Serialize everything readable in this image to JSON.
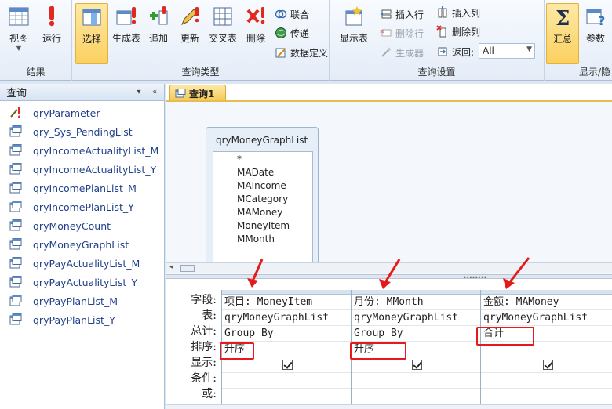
{
  "ribbon": {
    "results_group": {
      "label": "结果",
      "view": "视图",
      "run": "运行"
    },
    "query_type_group": {
      "label": "查询类型",
      "select": "选择",
      "make_table": "生成表",
      "append": "追加",
      "update": "更新",
      "crosstab": "交叉表",
      "delete": "删除",
      "union": "联合",
      "pass_through": "传递",
      "data_definition": "数据定义"
    },
    "query_setup_group": {
      "label": "查询设置",
      "show_table": "显示表",
      "insert_rows": "插入行",
      "delete_rows": "删除行",
      "builder": "生成器",
      "insert_columns": "插入列",
      "delete_columns": "删除列",
      "return": "返回:",
      "return_value": "All"
    },
    "show_hide_group": {
      "label": "显示/隐",
      "totals": "汇总",
      "parameters": "参数"
    }
  },
  "nav": {
    "title": "查询",
    "items": [
      "qryParameter",
      "qry_Sys_PendingList",
      "qryIncomeActualityList_M",
      "qryIncomeActualityList_Y",
      "qryIncomePlanList_M",
      "qryIncomePlanList_Y",
      "qryMoneyCount",
      "qryMoneyGraphList",
      "qryPayActualityList_M",
      "qryPayActualityList_Y",
      "qryPayPlanList_M",
      "qryPayPlanList_Y"
    ]
  },
  "doc": {
    "tab": "查询1",
    "table": {
      "name": "qryMoneyGraphList",
      "fields": [
        "*",
        "MADate",
        "MAIncome",
        "MCategory",
        "MAMoney",
        "MoneyItem",
        "MMonth"
      ]
    },
    "grid": {
      "row_labels": [
        "字段:",
        "表:",
        "总计:",
        "排序:",
        "显示:",
        "条件:",
        "或:"
      ],
      "columns": [
        {
          "field": "项目: MoneyItem",
          "table": "qryMoneyGraphList",
          "total": "Group By",
          "sort": "升序",
          "show": true
        },
        {
          "field": "月份: MMonth",
          "table": "qryMoneyGraphList",
          "total": "Group By",
          "sort": "升序",
          "show": true
        },
        {
          "field": "金额: MAMoney",
          "table": "qryMoneyGraphList",
          "total": "合计",
          "sort": "",
          "show": true
        }
      ]
    }
  },
  "colors": {
    "accent": "#fbd060",
    "highlight": "#e51b1b",
    "nav_text": "#1f3f8a"
  }
}
